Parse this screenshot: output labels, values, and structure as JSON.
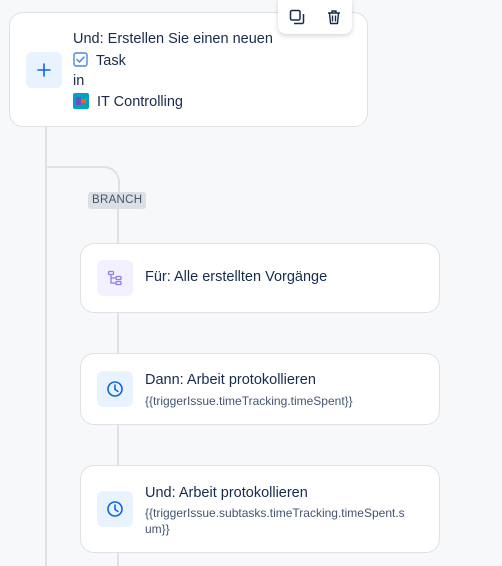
{
  "toolbar": {
    "duplicate_icon": "duplicate-icon",
    "delete_icon": "trash-icon"
  },
  "create_step": {
    "line1": "Und: Erstellen Sie einen neuen",
    "issue_type": "Task",
    "line3": "in",
    "project": "IT Controlling",
    "icon": "plus-icon"
  },
  "branch": {
    "label": "BRANCH"
  },
  "branch_rule": {
    "title": "Für: Alle erstellten Vorgänge",
    "icon": "branch-icon"
  },
  "log_work_1": {
    "title": "Dann: Arbeit protokollieren",
    "detail": "{{triggerIssue.timeTracking.timeSpent}}",
    "icon": "clock-icon"
  },
  "log_work_2": {
    "title": "Und: Arbeit protokollieren",
    "detail": "{{triggerIssue.subtasks.timeTracking.timeSpent.sum}}",
    "icon": "clock-icon"
  },
  "colors": {
    "accent_blue": "#0c66e4",
    "icon_bg_blue": "#e9f2ff",
    "icon_bg_purple": "#f3f0ff",
    "purple": "#8f7ee7",
    "checkbox_blue": "#4688ec"
  }
}
